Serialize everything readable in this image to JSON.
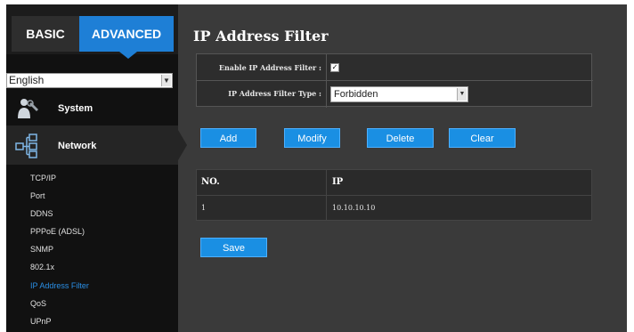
{
  "tabs": {
    "basic": "BASIC",
    "advanced": "ADVANCED"
  },
  "language": {
    "selected": "English"
  },
  "menu": {
    "system": "System",
    "network": "Network",
    "network_items": [
      "TCP/IP",
      "Port",
      "DDNS",
      "PPPoE (ADSL)",
      "SNMP",
      "802.1x",
      "IP Address Filter",
      "QoS",
      "UPnP"
    ],
    "active_item": "IP Address Filter"
  },
  "page": {
    "title": "IP Address Filter"
  },
  "form": {
    "enable_label": "Enable IP Address Filter :",
    "enable_checked": true,
    "type_label": "IP Address Filter Type :",
    "type_value": "Forbidden"
  },
  "buttons": {
    "add": "Add",
    "modify": "Modify",
    "delete": "Delete",
    "clear": "Clear",
    "save": "Save"
  },
  "table": {
    "headers": {
      "no": "NO.",
      "ip": "IP"
    },
    "rows": [
      {
        "no": "1",
        "ip": "10.10.10.10"
      }
    ]
  },
  "colors": {
    "accent": "#1a8fe3",
    "active_link": "#2a8fe6",
    "background": "#3a3a3a",
    "sidebar": "#111111"
  }
}
